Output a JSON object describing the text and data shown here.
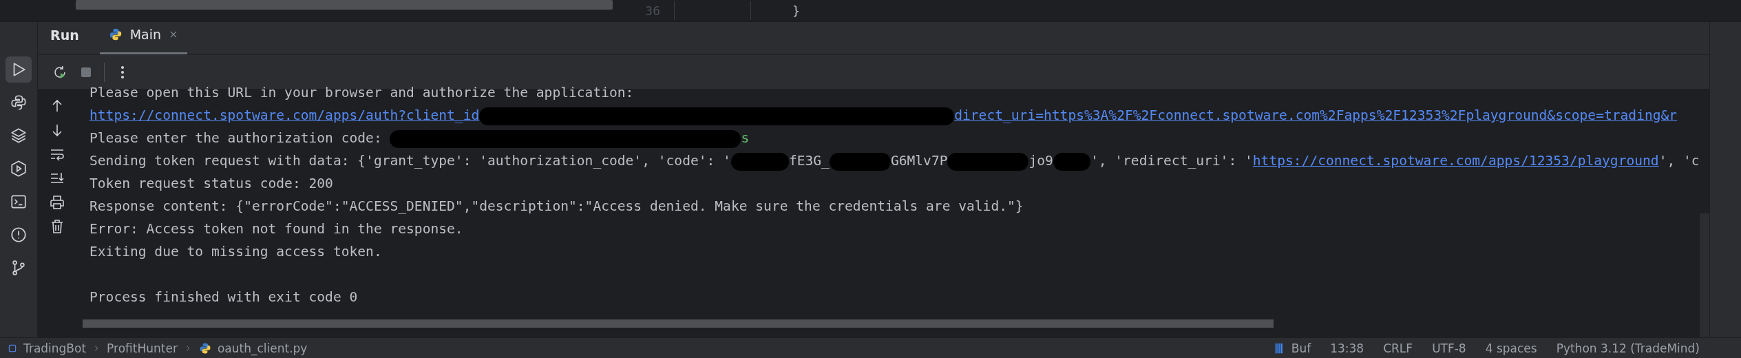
{
  "editor_peek": {
    "line_number": "36",
    "code": "}"
  },
  "tool_window": {
    "title": "Run",
    "tabs": [
      {
        "label": "Main",
        "selected": true,
        "closable": true
      }
    ]
  },
  "sidebar": {
    "items": [
      {
        "selected": true
      },
      {
        "selected": false
      },
      {
        "selected": false
      },
      {
        "selected": false
      },
      {
        "selected": false
      },
      {
        "selected": false
      },
      {
        "selected": false
      }
    ]
  },
  "console": {
    "lines": [
      {
        "segments": [
          {
            "kind": "text",
            "text": "Please open this URL in your browser and authorize the application:"
          }
        ]
      },
      {
        "segments": [
          {
            "kind": "link",
            "text": "https://connect.spotware.com/apps/auth?client_id"
          },
          {
            "kind": "redacted"
          },
          {
            "kind": "link",
            "text": "direct_uri=https%3A%2F%2Fconnect.spotware.com%2Fapps%2F12353%2Fplayground&scope=trading&r"
          }
        ]
      },
      {
        "segments": [
          {
            "kind": "text",
            "text": "Please enter the authorization code: "
          },
          {
            "kind": "redacted"
          },
          {
            "kind": "input",
            "text": "s"
          }
        ]
      },
      {
        "segments": [
          {
            "kind": "text",
            "text": "Sending token request with data: {'grant_type': 'authorization_code', 'code': '"
          },
          {
            "kind": "redacted"
          },
          {
            "kind": "text",
            "text": "fE3G_"
          },
          {
            "kind": "redacted"
          },
          {
            "kind": "text",
            "text": "G6Mlv7P"
          },
          {
            "kind": "redacted"
          },
          {
            "kind": "text",
            "text": "jo9"
          },
          {
            "kind": "redacted"
          },
          {
            "kind": "text",
            "text": "', 'redirect_uri': '"
          },
          {
            "kind": "link",
            "text": "https://connect.spotware.com/apps/12353/playground"
          },
          {
            "kind": "text",
            "text": "', 'c"
          }
        ]
      },
      {
        "segments": [
          {
            "kind": "text",
            "text": "Token request status code: 200"
          }
        ]
      },
      {
        "segments": [
          {
            "kind": "text",
            "text": "Response content: {\"errorCode\":\"ACCESS_DENIED\",\"description\":\"Access denied. Make sure the credentials are valid.\"}"
          }
        ]
      },
      {
        "segments": [
          {
            "kind": "text",
            "text": "Error: Access token not found in the response."
          }
        ]
      },
      {
        "segments": [
          {
            "kind": "text",
            "text": "Exiting due to missing access token."
          }
        ]
      }
    ],
    "exit_message": "Process finished with exit code 0"
  },
  "status_bar": {
    "breadcrumbs": [
      "TradingBot",
      "ProfitHunter",
      "oauth_client.py"
    ],
    "items": [
      "Buf",
      "13:38",
      "CRLF",
      "UTF-8",
      "4 spaces",
      "Python 3.12 (TradeMind)"
    ]
  }
}
